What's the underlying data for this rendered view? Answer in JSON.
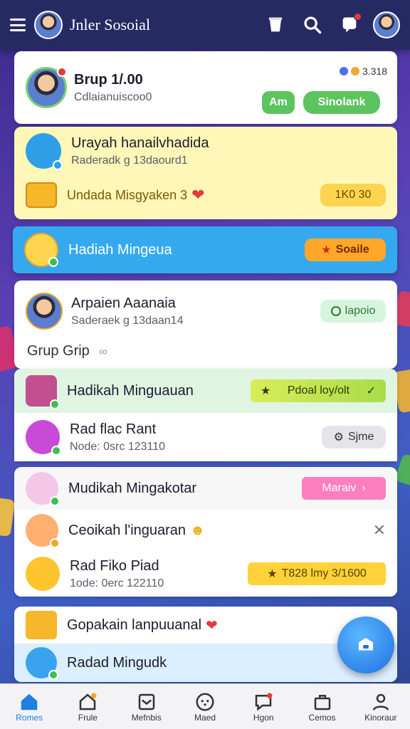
{
  "header": {
    "app_title": "Jnler Sosoial"
  },
  "group": {
    "name": "Brup 1/.00",
    "handle": "Cdlaianuiscoo0",
    "members": "3.318",
    "btn_primary": "Am",
    "btn_secondary": "Sinolank"
  },
  "yellow": {
    "title": "Urayah hanailvhadida",
    "sub": "Raderadk g 13daourd1",
    "promo_label": "Undada Misgyaken 3",
    "promo_value": "1K0 30"
  },
  "blue": {
    "label": "Hadiah Mingeua",
    "pill": "Soaile"
  },
  "white": {
    "title": "Arpaien Aaanaia",
    "sub": "Saderaek g 13daan14",
    "pill": "lapoio"
  },
  "section_title": "Grup Grip",
  "list1": {
    "row1_title": "Hadikah Minguauan",
    "row1_pill": "Pdoal loy/olt",
    "row2_title": "Rad flac Rant",
    "row2_sub": "Node: 0src 123110",
    "row2_pill": "Sjme"
  },
  "list2": {
    "row1_title": "Mudikah Mingakotar",
    "row1_pill": "Maraiv",
    "row2_title": "Ceoikah l'inguaran",
    "row3_title": "Rad Fiko Piad",
    "row3_sub": "1ode: 0erc 122110",
    "row3_pill": "T828 lmy 3/1600"
  },
  "list3": {
    "row1_title": "Gopakain lanpuuanal",
    "row2_title": "Radad Mingudk"
  },
  "nav": [
    {
      "label": "Romes",
      "icon": "home-icon"
    },
    {
      "label": "Frule",
      "icon": "house-icon"
    },
    {
      "label": "Mefnbis",
      "icon": "mail-icon"
    },
    {
      "label": "Maed",
      "icon": "face-icon"
    },
    {
      "label": "Hgon",
      "icon": "chat-icon"
    },
    {
      "label": "Cemos",
      "icon": "bag-icon"
    },
    {
      "label": "Kinoraur",
      "icon": "user-icon"
    }
  ],
  "colors": {
    "header_bg": "#262a63",
    "accent_blue": "#34a9ef",
    "green": "#5bc45e"
  }
}
